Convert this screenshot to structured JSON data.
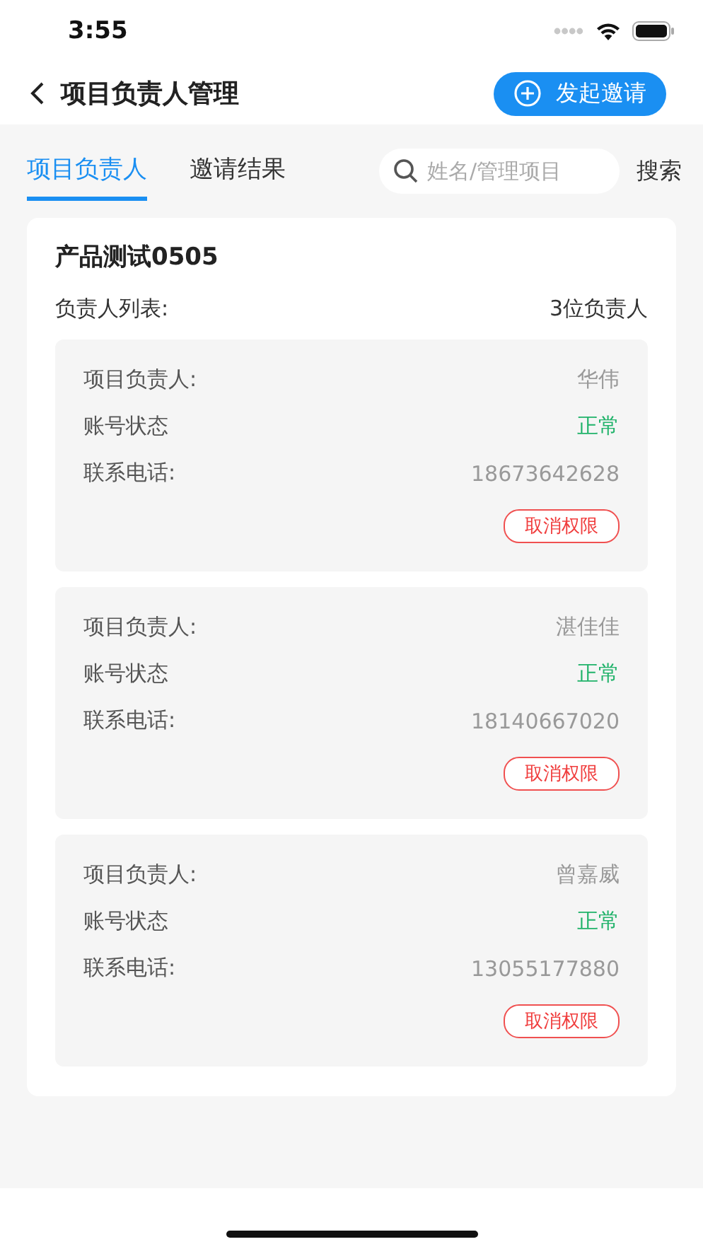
{
  "status_bar": {
    "time": "3:55"
  },
  "header": {
    "title": "项目负责人管理",
    "action": "发起邀请"
  },
  "tabs": [
    {
      "label": "项目负责人",
      "selected": true
    },
    {
      "label": "邀请结果",
      "selected": false
    }
  ],
  "search": {
    "placeholder": "姓名/管理项目",
    "button": "搜索"
  },
  "project": {
    "name": "产品测试0505",
    "list_label": "负责人列表:",
    "count": "3位负责人",
    "managers": [
      {
        "name_label": "项目负责人:",
        "name": "华伟",
        "status_label": "账号状态",
        "status": {
          "text": "正常",
          "kind": "normal"
        },
        "phone_label": "联系电话:",
        "phone": "18673642628",
        "action": "取消权限"
      },
      {
        "name_label": "项目负责人:",
        "name": "湛佳佳",
        "status_label": "账号状态",
        "status": {
          "text": "正常",
          "kind": "normal"
        },
        "phone_label": "联系电话:",
        "phone": "18140667020",
        "action": "取消权限"
      },
      {
        "name_label": "项目负责人:",
        "name": "曾嘉威",
        "status_label": "账号状态",
        "status": {
          "text": "正常",
          "kind": "normal"
        },
        "phone_label": "联系电话:",
        "phone": "13055177880",
        "action": "取消权限"
      }
    ]
  }
}
